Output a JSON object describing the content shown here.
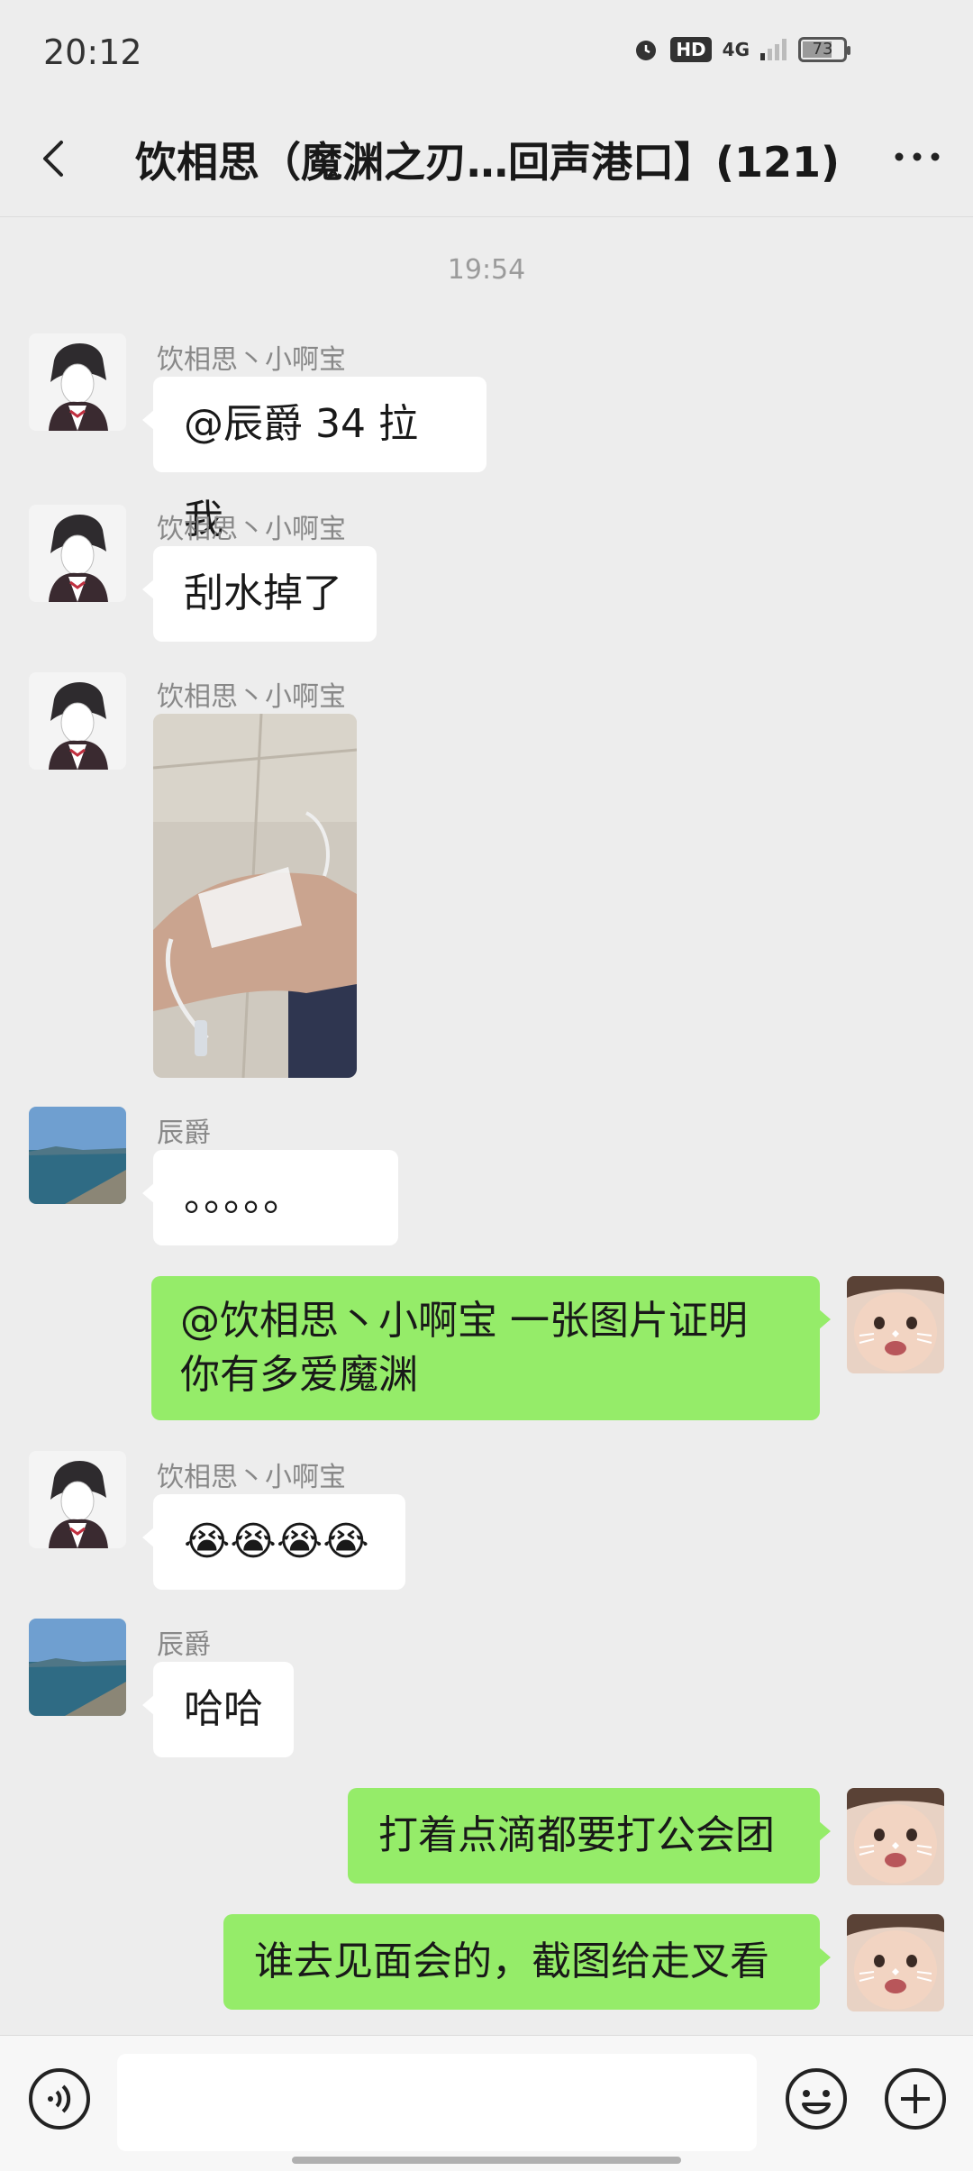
{
  "status_bar": {
    "time": "20:12",
    "hd": "HD",
    "network": "4G",
    "battery": "73",
    "battery_level": 0.73
  },
  "header": {
    "title": "饮相思（魔渊之刃…回声港口】(121)"
  },
  "chat": {
    "time_separator": "19:54",
    "messages": [
      {
        "sender": "饮相思丶小啊宝",
        "text": "@辰爵  34 拉我"
      },
      {
        "sender": "饮相思丶小啊宝",
        "text": "刮水掉了"
      },
      {
        "sender": "饮相思丶小啊宝",
        "image": "photo-hand-iv-drip"
      },
      {
        "sender": "辰爵",
        "text": "。。。。。"
      },
      {
        "sender": "me",
        "line1": "@饮相思丶小啊宝  一张图片证明",
        "line2": "你有多爱魔渊"
      },
      {
        "sender": "饮相思丶小啊宝",
        "text": "😭😭😭😭"
      },
      {
        "sender": "辰爵",
        "text": "哈哈"
      },
      {
        "sender": "me",
        "text": "打着点滴都要打公会团"
      },
      {
        "sender": "me",
        "text": "谁去见面会的，截图给走叉看"
      }
    ]
  },
  "colors": {
    "background": "#ededed",
    "my_bubble": "#95ec69",
    "their_bubble": "#ffffff"
  },
  "icons": {
    "back": "chevron-left-icon",
    "more": "ellipsis-icon",
    "voice": "voice-icon",
    "emoji": "emoji-icon",
    "plus": "plus-icon"
  }
}
